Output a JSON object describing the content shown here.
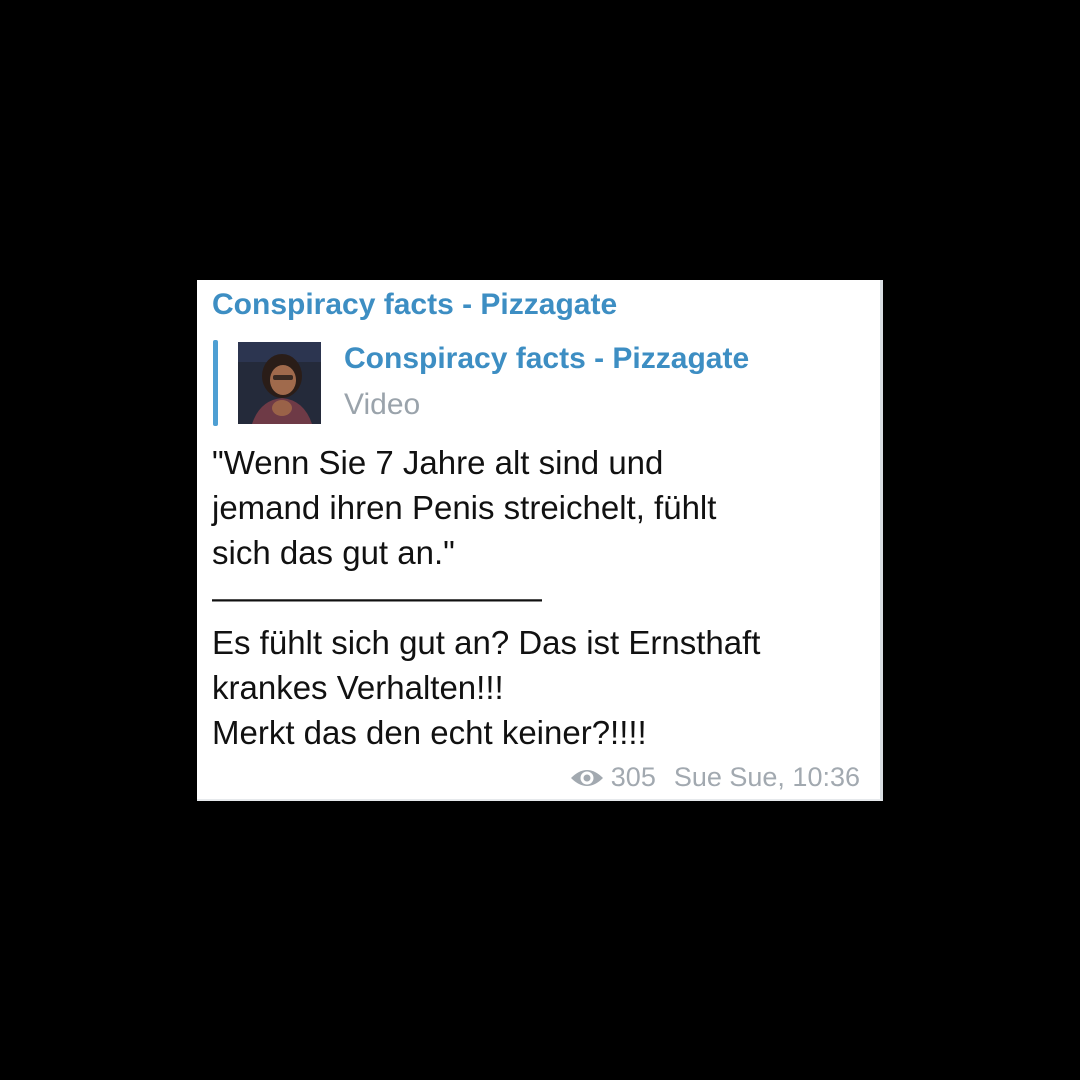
{
  "message": {
    "channel_name": "Conspiracy facts - Pizzagate",
    "forwarded": {
      "title": "Conspiracy facts - Pizzagate",
      "media_type": "Video",
      "thumbnail_icon": "video-thumbnail"
    },
    "body_lines": [
      "\"Wenn Sie 7 Jahre alt sind und",
      "jemand ihren Penis streichelt, fühlt",
      "sich das gut an.\"",
      "——————————",
      "Es fühlt sich gut an? Das ist Ernsthaft",
      "krankes Verhalten!!!",
      "Merkt das den echt keiner?!!!!"
    ],
    "views": "305",
    "author_time": "Sue Sue, 10:36",
    "views_icon": "eye-icon"
  },
  "colors": {
    "background": "#000000",
    "bubble": "#ffffff",
    "accent": "#3d8ec3",
    "forward_bar": "#4e9fd3",
    "meta_text": "#a2a9b0"
  }
}
